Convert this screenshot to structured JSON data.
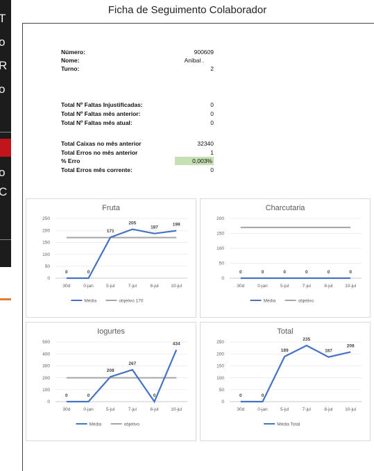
{
  "background_window": {
    "letters": [
      "T",
      "o",
      "R",
      "o",
      "o",
      "C"
    ],
    "colors": {
      "dark": "#1c1c1c",
      "red": "#c0151b",
      "orange": "#e07a2e"
    }
  },
  "title": "Ficha de Seguimento Colaborador",
  "info": {
    "numero_label": "Número:",
    "numero_value": "900609",
    "nome_label": "Nome:",
    "nome_value": "Anibal .",
    "turno_label": "Turno:",
    "turno_value": "2",
    "faltas_inj_label": "Total Nº Faltas Injustificadas:",
    "faltas_inj_value": "0",
    "faltas_ant_label": "Total Nº Faltas mês anterior:",
    "faltas_ant_value": "0",
    "faltas_atual_label": "Total Nº Faltas mês atual:",
    "faltas_atual_value": "0",
    "caixas_label": "Total Caixas no mês anterior",
    "caixas_value": "32340",
    "erros_ant_label": "Total Erros no mês anterior",
    "erros_ant_value": "1",
    "perc_erro_label": "% Erro",
    "perc_erro_value": "0,003%",
    "erros_corr_label": "Total Erros mês corrente:",
    "erros_corr_value": "0"
  },
  "colors": {
    "series": "#4472c4",
    "objective": "#a5a5a5",
    "highlight": "#c6e0b4"
  },
  "chart_data": [
    {
      "type": "line",
      "title": "Fruta",
      "categories": [
        "30d",
        "0-jan",
        "5-jul",
        "7-jul",
        "8-jul",
        "10-jul"
      ],
      "ylim": [
        0,
        250
      ],
      "yticks": [
        "0",
        "50",
        "100",
        "150",
        "200",
        "250"
      ],
      "series": [
        {
          "name": "Média",
          "values": [
            0,
            0,
            171,
            205,
            187,
            199
          ],
          "labels": [
            "0",
            "0",
            "171",
            "205",
            "187",
            "199"
          ]
        },
        {
          "name": "objetivo 170",
          "values": [
            170,
            170,
            170,
            170,
            170,
            170
          ]
        }
      ],
      "grid": true,
      "legend": "bottom"
    },
    {
      "type": "line",
      "title": "Charcutaria",
      "categories": [
        "30d",
        "0-jan",
        "5-jul",
        "7-jul",
        "8-jul",
        "10-jul"
      ],
      "ylim": [
        0,
        200
      ],
      "yticks": [
        "0",
        "50",
        "100",
        "150",
        "200"
      ],
      "series": [
        {
          "name": "Média",
          "values": [
            0,
            0,
            0,
            0,
            0,
            0
          ],
          "labels": [
            "0",
            "0",
            "0",
            "0",
            "0",
            "0"
          ]
        },
        {
          "name": "objetivo",
          "values": [
            170,
            170,
            170,
            170,
            170,
            170
          ]
        }
      ],
      "grid": true,
      "legend": "bottom"
    },
    {
      "type": "line",
      "title": "Iogurtes",
      "categories": [
        "30d",
        "0-jan",
        "5-jul",
        "7-jul",
        "8-jul",
        "10-jul"
      ],
      "ylim": [
        0,
        500
      ],
      "yticks": [
        "0",
        "100",
        "200",
        "300",
        "400",
        "500"
      ],
      "series": [
        {
          "name": "Média",
          "values": [
            0,
            0,
            208,
            267,
            0,
            434
          ],
          "labels": [
            "0",
            "0",
            "208",
            "267",
            "0",
            "434"
          ]
        },
        {
          "name": "objetivo",
          "values": [
            200,
            200,
            200,
            200,
            200,
            200
          ]
        }
      ],
      "grid": true,
      "legend": "bottom"
    },
    {
      "type": "line",
      "title": "Total",
      "categories": [
        "30d",
        "0-jan",
        "5-jul",
        "7-jul",
        "8-jul",
        "10-jul"
      ],
      "ylim": [
        0,
        250
      ],
      "yticks": [
        "0",
        "50",
        "100",
        "150",
        "200",
        "250"
      ],
      "series": [
        {
          "name": "Média Total",
          "values": [
            0,
            0,
            189,
            235,
            187,
            208
          ],
          "labels": [
            "0",
            "0",
            "189",
            "235",
            "187",
            "208"
          ]
        }
      ],
      "grid": true,
      "legend": "bottom"
    }
  ]
}
